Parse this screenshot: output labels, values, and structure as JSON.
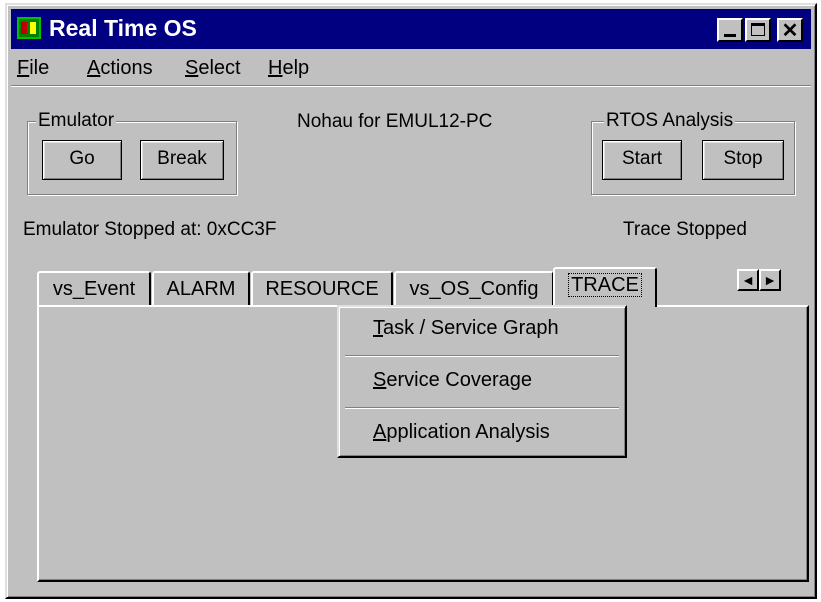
{
  "window": {
    "title": "Real Time OS",
    "controls": {
      "minimize": "_",
      "maximize": "□",
      "close": "✕"
    }
  },
  "menu": {
    "items": [
      {
        "mnemonic": "F",
        "rest": "ile"
      },
      {
        "mnemonic": "A",
        "rest": "ctions"
      },
      {
        "mnemonic": "S",
        "rest": "elect"
      },
      {
        "mnemonic": "H",
        "rest": "elp"
      }
    ]
  },
  "emulator_group": {
    "label": "Emulator",
    "go_label": "Go",
    "break_label": "Break"
  },
  "target_label": "Nohau for EMUL12-PC",
  "rtos_group": {
    "label": "RTOS  Analysis",
    "start_label": "Start",
    "stop_label": "Stop"
  },
  "status": {
    "emulator": "Emulator Stopped at: 0xCC3F",
    "trace": "Trace Stopped"
  },
  "tabs": [
    {
      "label": "vs_Event",
      "active": false
    },
    {
      "label": "ALARM",
      "active": false
    },
    {
      "label": "RESOURCE",
      "active": false
    },
    {
      "label": "vs_OS_Config",
      "active": false
    },
    {
      "label": "TRACE",
      "active": true
    }
  ],
  "tab_scroll": {
    "left": "◄",
    "right": "►"
  },
  "popup_menu": {
    "items": [
      {
        "mnemonic": "T",
        "rest": "ask / Service Graph"
      },
      {
        "mnemonic": "S",
        "rest": "ervice Coverage"
      },
      {
        "mnemonic": "A",
        "rest": "pplication Analysis"
      }
    ]
  }
}
